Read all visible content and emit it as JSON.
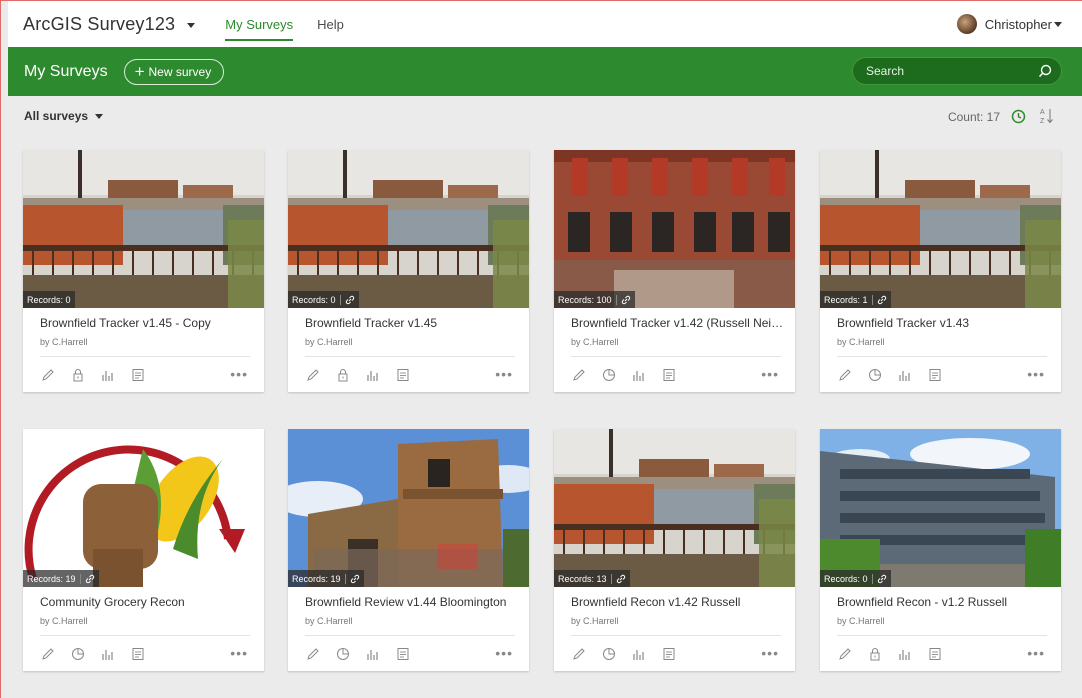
{
  "topbar": {
    "app_title": "ArcGIS Survey123",
    "nav": [
      {
        "label": "My Surveys",
        "active": true
      },
      {
        "label": "Help",
        "active": false
      }
    ],
    "user_name": "Christopher"
  },
  "header": {
    "title": "My Surveys",
    "new_survey_label": "New survey",
    "search_placeholder": "Search"
  },
  "toolbar": {
    "filter_label": "All surveys",
    "count_text": "Count: 17"
  },
  "colors": {
    "brand_green": "#2e8a2e",
    "dark_green": "#1d6b1d"
  },
  "surveys": [
    {
      "title": "Brownfield Tracker v1.45 - Copy",
      "owner": "by C.Harrell",
      "records": "Records: 0",
      "shared": false,
      "access_icon": "lock-icon",
      "image": "industrial-scene"
    },
    {
      "title": "Brownfield Tracker v1.45",
      "owner": "by C.Harrell",
      "records": "Records: 0",
      "shared": true,
      "access_icon": "lock-icon",
      "image": "industrial-scene"
    },
    {
      "title": "Brownfield Tracker v1.42 (Russell Nei…",
      "owner": "by C.Harrell",
      "records": "Records: 100",
      "shared": true,
      "access_icon": "globe-icon",
      "image": "brick-building"
    },
    {
      "title": "Brownfield Tracker v1.43",
      "owner": "by C.Harrell",
      "records": "Records: 1",
      "shared": true,
      "access_icon": "globe-icon",
      "image": "industrial-scene"
    },
    {
      "title": "Community Grocery Recon",
      "owner": "by C.Harrell",
      "records": "Records: 19",
      "shared": true,
      "access_icon": "globe-icon",
      "image": "corn-fist-logo"
    },
    {
      "title": "Brownfield Review v1.44 Bloomington",
      "owner": "by C.Harrell",
      "records": "Records: 19",
      "shared": true,
      "access_icon": "globe-icon",
      "image": "graffiti-building"
    },
    {
      "title": "Brownfield Recon v1.42 Russell",
      "owner": "by C.Harrell",
      "records": "Records: 13",
      "shared": true,
      "access_icon": "globe-icon",
      "image": "industrial-scene"
    },
    {
      "title": "Brownfield Recon - v1.2 Russell",
      "owner": "by C.Harrell",
      "records": "Records: 0",
      "shared": true,
      "access_icon": "lock-icon",
      "image": "factory-building"
    }
  ]
}
